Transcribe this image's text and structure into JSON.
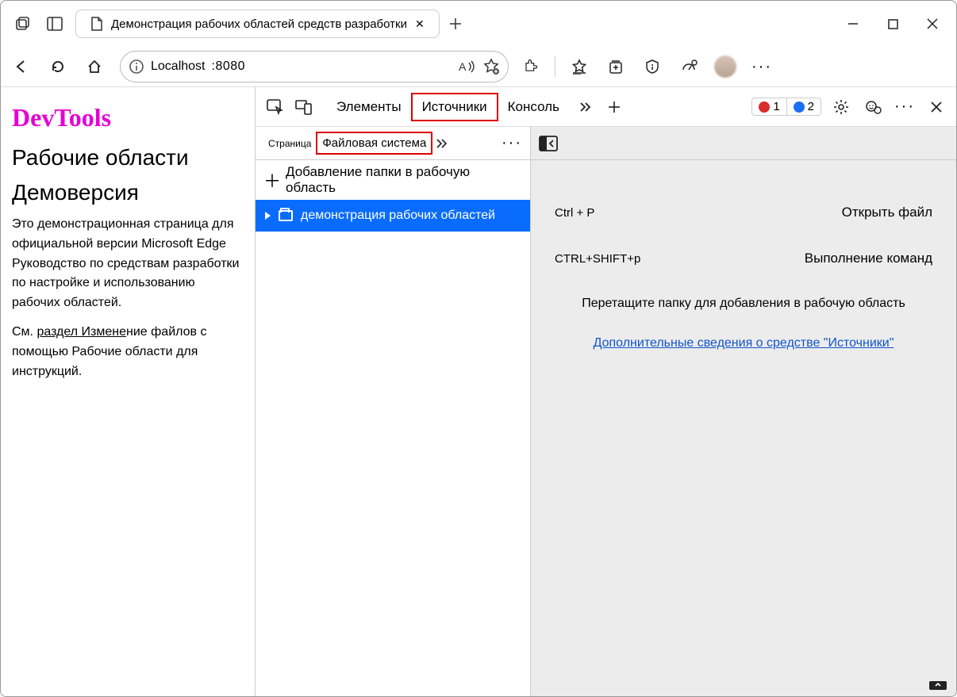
{
  "tab": {
    "title": "Демонстрация рабочих областей средств разработки"
  },
  "addr": {
    "host": "Localhost",
    "port": ":8080"
  },
  "page": {
    "brand": "DevTools",
    "h1": "Рабочие области",
    "h2": "Демоверсия",
    "p1": "Это демонстрационная страница для официальной версии Microsoft Edge Руководство по средствам разработки по настройке и использованию рабочих областей.",
    "p2_prefix": "См. ",
    "p2_link": "раздел Измене",
    "p2_rest": "ние файлов с помощью Рабочие области для инструкций."
  },
  "dt": {
    "tabs": {
      "elements": "Элементы",
      "sources": "Источники",
      "console": "Консоль"
    },
    "errors": "1",
    "issues": "2",
    "src_tabs": {
      "page": "Страница",
      "fs": "Файловая система"
    },
    "add_folder": "Добавление папки в рабочую область",
    "folder": "демонстрация рабочих областей",
    "hints": {
      "k1": "Ctrl + P",
      "v1": "Открыть файл",
      "k2": "CTRL+SHIFT+p",
      "v2": "Выполнение команд",
      "drop": "Перетащите папку для добавления в рабочую область",
      "link": "Дополнительные сведения о средстве \"Источники\""
    }
  }
}
